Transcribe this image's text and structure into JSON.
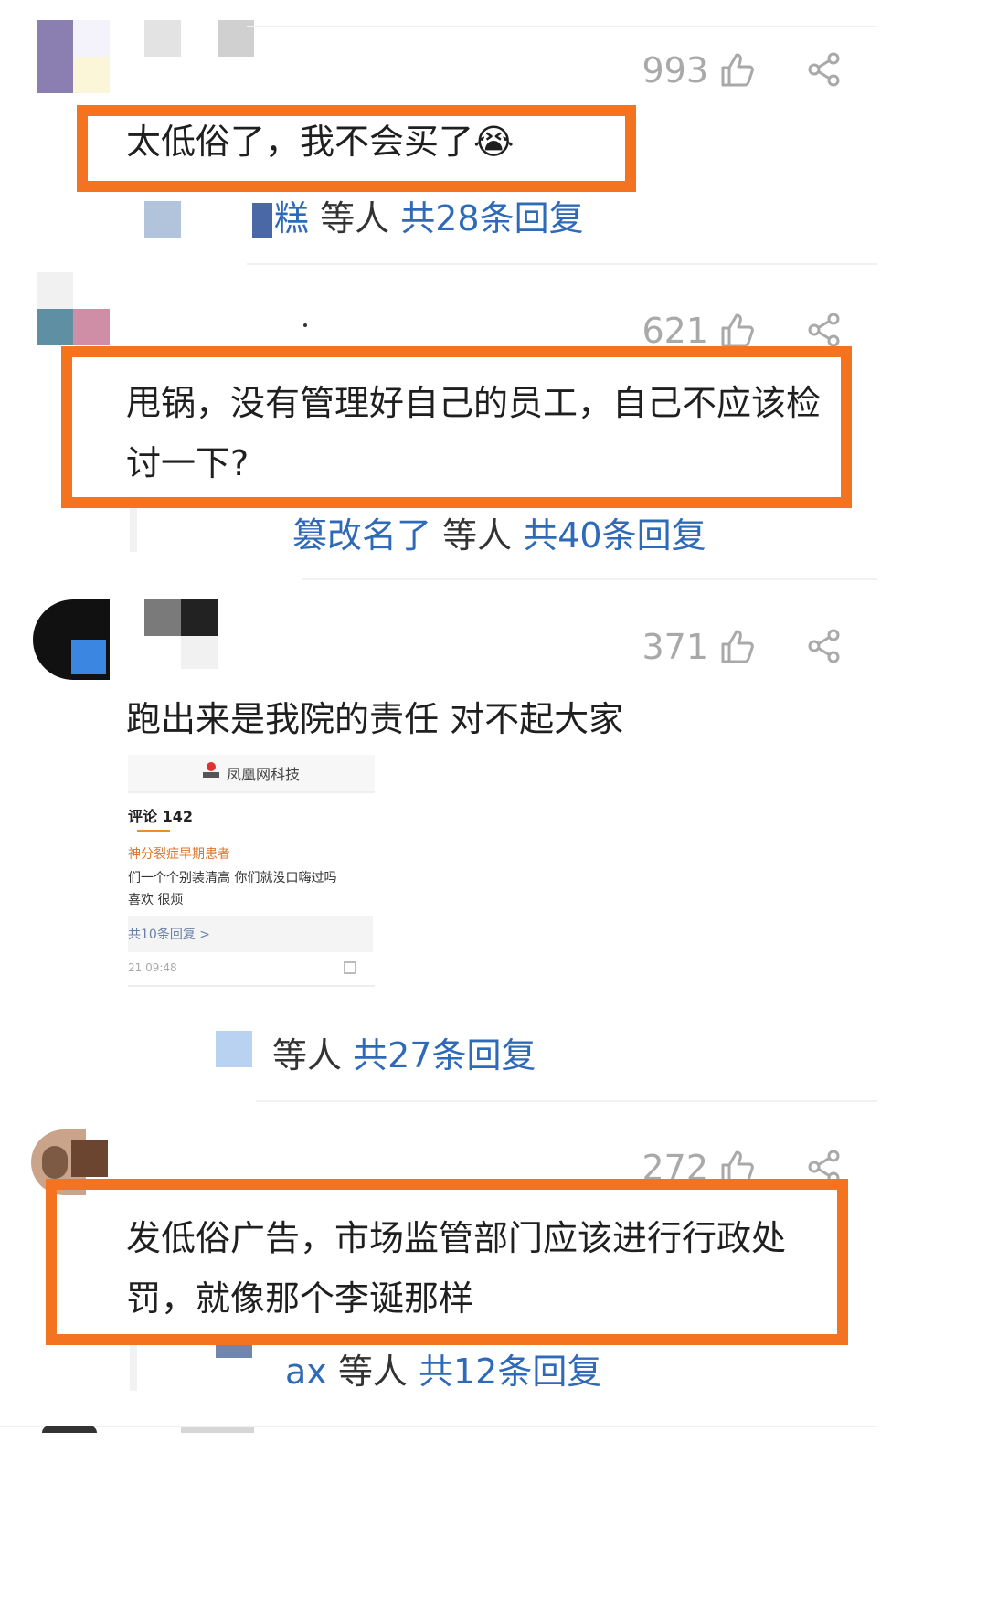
{
  "comments": [
    {
      "likes": "993",
      "text": "太低俗了，我不会买了😭",
      "reply": {
        "who": "糕",
        "etc": "等人",
        "total": "共28条回复"
      }
    },
    {
      "likes": "621",
      "text_line1": "甩锅，没有管理好自己的员工，自己不应该检",
      "text_line2": "讨一下?",
      "reply": {
        "who": "篡改名了",
        "etc": "等人",
        "total": "共40条回复"
      }
    },
    {
      "likes": "371",
      "text": "跑出来是我院的责任 对不起大家",
      "embed": {
        "brand": "凤凰网科技",
        "comments_count": "评论 142",
        "user": "神分裂症早期患者",
        "body_line1": "们一个个别装清高 你们就没口嗨过吗",
        "body_line2": "喜欢 很烦",
        "replies": "共10条回复 >",
        "time": "21 09:48"
      },
      "reply": {
        "etc": "等人",
        "total": "共27条回复"
      }
    },
    {
      "likes": "272",
      "text_line1": "发低俗广告，市场监管部门应该进行行政处",
      "text_line2": "罚，就像那个李诞那样",
      "reply": {
        "who": "ax",
        "etc": "等人",
        "total": "共12条回复"
      }
    }
  ],
  "colors": {
    "highlight": "#f47321",
    "link": "#2f6ab8",
    "muted": "#a9a9a9"
  },
  "icons": [
    "thumbs-up-icon",
    "share-icon"
  ]
}
